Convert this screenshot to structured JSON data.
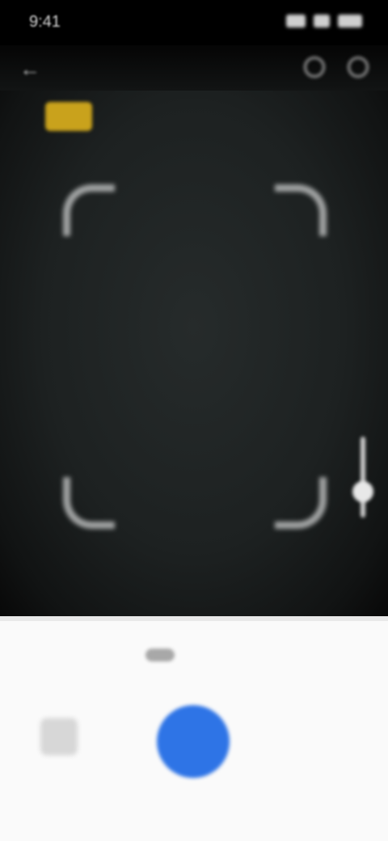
{
  "status_bar": {
    "time": "9:41"
  },
  "app_bar": {
    "back_glyph": "←"
  },
  "mode_chip": {
    "label": ""
  },
  "tabs": [
    {
      "label": ""
    },
    {
      "label": ""
    }
  ],
  "colors": {
    "accent": "#2e74e6",
    "chip": "#c9a21c",
    "sheet_background": "#fafafa"
  },
  "icons": [
    "back-icon",
    "flash-icon",
    "settings-icon",
    "gallery-icon",
    "shutter-icon"
  ]
}
